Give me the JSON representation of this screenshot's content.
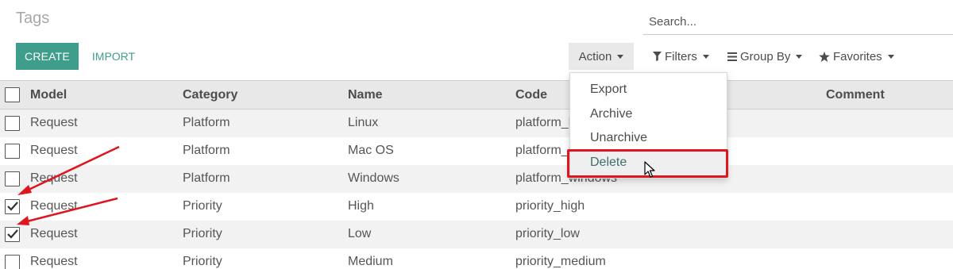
{
  "header": {
    "title": "Tags",
    "search_placeholder": "Search..."
  },
  "toolbar": {
    "create_label": "CREATE",
    "import_label": "IMPORT",
    "action_label": "Action",
    "filters_label": "Filters",
    "groupby_label": "Group By",
    "favorites_label": "Favorites"
  },
  "action_menu": {
    "items": [
      "Export",
      "Archive",
      "Unarchive",
      "Delete"
    ],
    "highlighted": "Delete"
  },
  "table": {
    "columns": [
      "Model",
      "Category",
      "Name",
      "Code",
      "Comment"
    ],
    "rows": [
      {
        "model": "Request",
        "category": "Platform",
        "name": "Linux",
        "code": "platform_linux",
        "comment": "",
        "checked": false
      },
      {
        "model": "Request",
        "category": "Platform",
        "name": "Mac OS",
        "code": "platform_macos",
        "comment": "",
        "checked": false
      },
      {
        "model": "Request",
        "category": "Platform",
        "name": "Windows",
        "code": "platform_windows",
        "comment": "",
        "checked": false
      },
      {
        "model": "Request",
        "category": "Priority",
        "name": "High",
        "code": "priority_high",
        "comment": "",
        "checked": true
      },
      {
        "model": "Request",
        "category": "Priority",
        "name": "Low",
        "code": "priority_low",
        "comment": "",
        "checked": true
      },
      {
        "model": "Request",
        "category": "Priority",
        "name": "Medium",
        "code": "priority_medium",
        "comment": "",
        "checked": false
      }
    ]
  },
  "colors": {
    "primary": "#3f9d8b",
    "annotation_red": "#e0151f"
  }
}
